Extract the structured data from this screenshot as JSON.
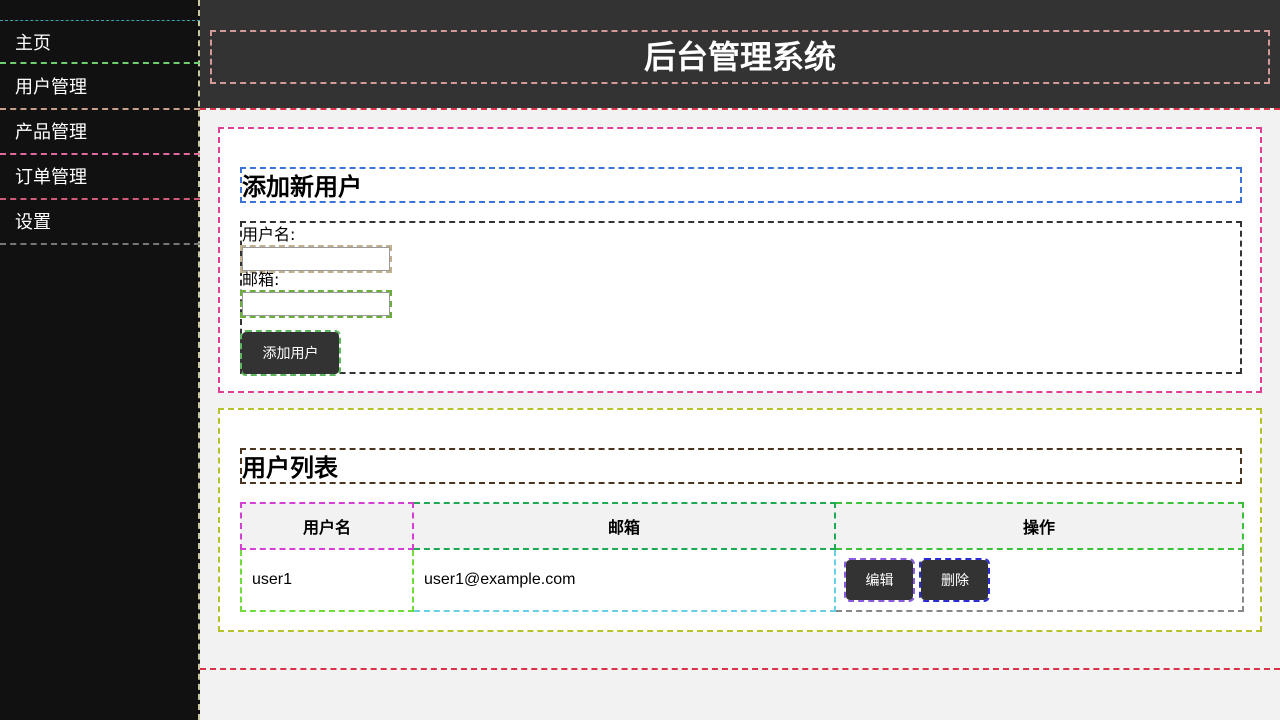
{
  "sidebar": {
    "items": [
      {
        "label": "主页"
      },
      {
        "label": "用户管理"
      },
      {
        "label": "产品管理"
      },
      {
        "label": "订单管理"
      },
      {
        "label": "设置"
      }
    ]
  },
  "header": {
    "title": "后台管理系统"
  },
  "add_user": {
    "title": "添加新用户",
    "username_label": "用户名:",
    "username_value": "",
    "email_label": "邮箱:",
    "email_value": "",
    "submit_label": "添加用户"
  },
  "user_list": {
    "title": "用户列表",
    "columns": [
      "用户名",
      "邮箱",
      "操作"
    ],
    "rows": [
      {
        "username": "user1",
        "email": "user1@example.com",
        "edit_label": "编辑",
        "delete_label": "删除"
      }
    ]
  },
  "colors": {
    "sidebar_bg": "#111111",
    "header_bg": "#333333",
    "button_bg": "#333333",
    "page_bg": "#f2f2f2"
  }
}
